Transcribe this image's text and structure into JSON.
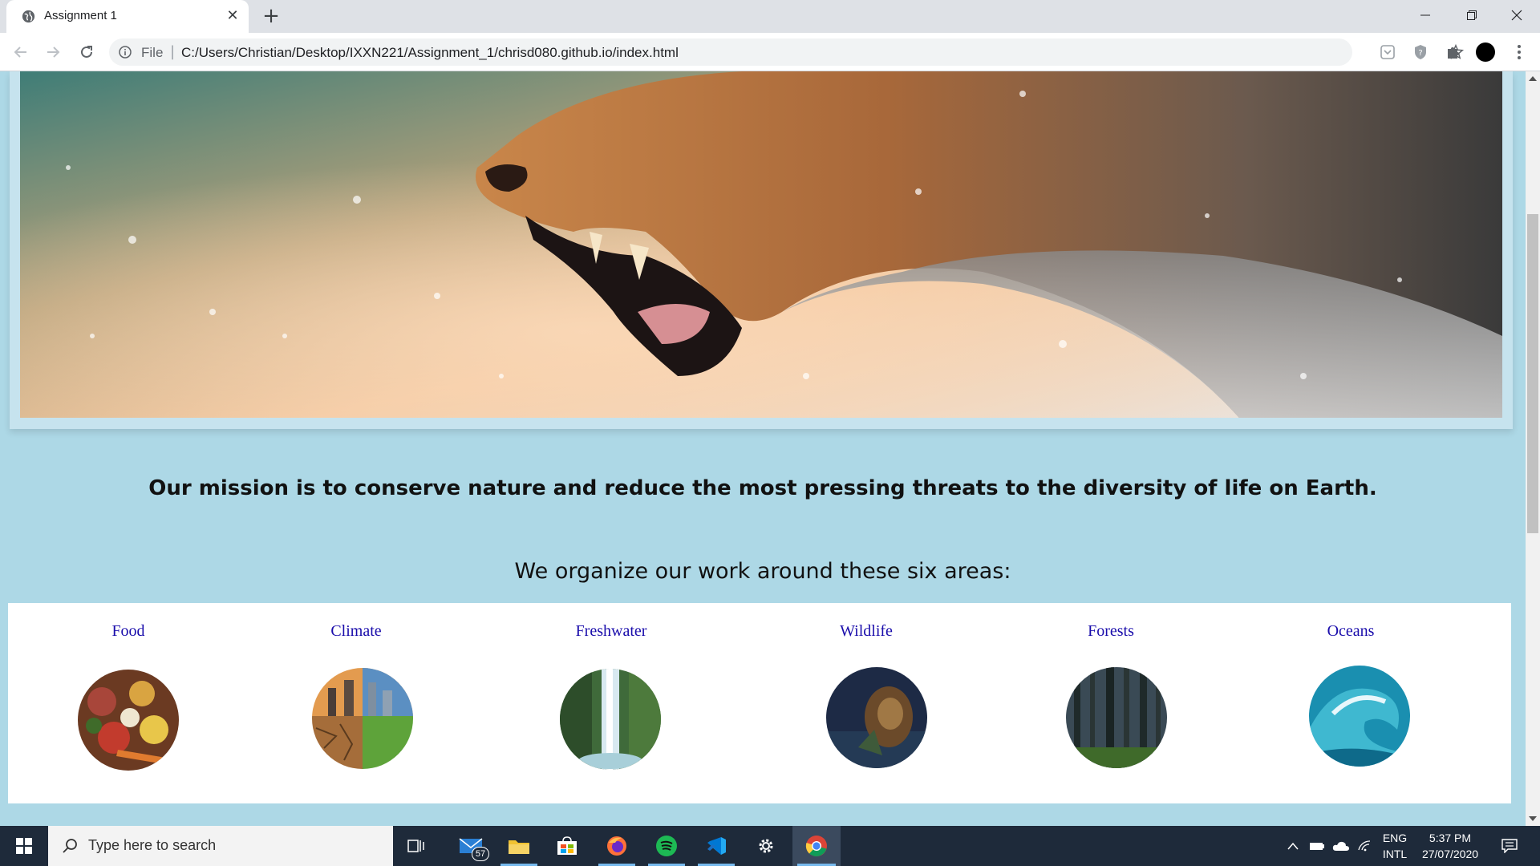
{
  "browser": {
    "tab_title": "Assignment 1",
    "file_label": "File",
    "url": "C:/Users/Christian/Desktop/IXXN221/Assignment_1/chrisd080.github.io/index.html"
  },
  "page": {
    "hero_alt": "roaring cougar",
    "mission": "Our mission is to conserve nature and reduce the most pressing threats to the diversity of life on Earth.",
    "areas_heading": "We organize our work around these six areas:",
    "areas": [
      {
        "label": "Food"
      },
      {
        "label": "Climate"
      },
      {
        "label": "Freshwater"
      },
      {
        "label": "Wildlife"
      },
      {
        "label": "Forests"
      },
      {
        "label": "Oceans"
      }
    ],
    "link_color": "#1a0dab",
    "background_color": "#add8e6"
  },
  "taskbar": {
    "search_placeholder": "Type here to search",
    "mail_badge": "57",
    "language": "ENG",
    "layout": "INTL",
    "time": "5:37 PM",
    "date": "27/07/2020"
  }
}
